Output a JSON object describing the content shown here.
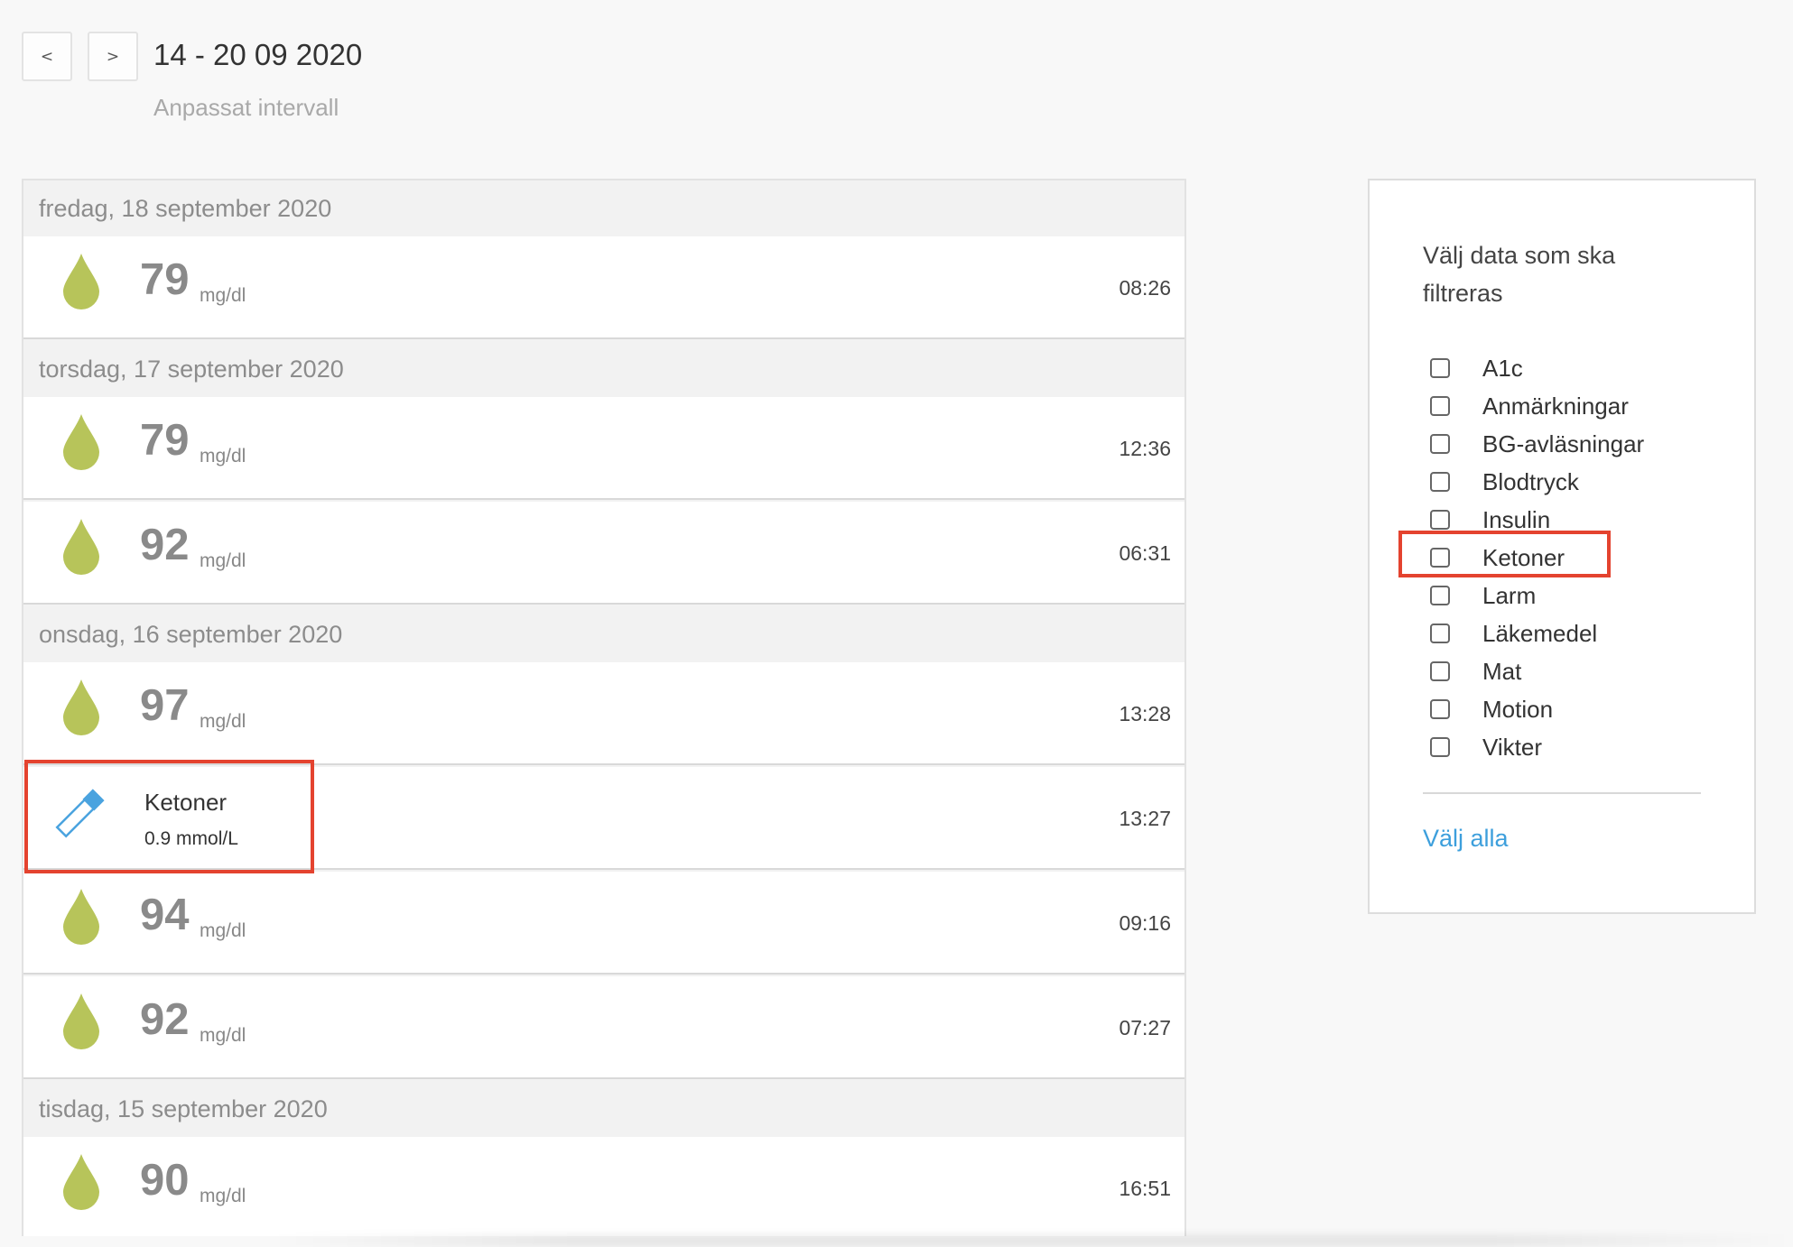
{
  "header": {
    "prev_label": "<",
    "next_label": ">",
    "date_range": "14 - 20 09 2020",
    "custom_range": "Anpassat intervall"
  },
  "colors": {
    "drop_green": "#b7c45a",
    "strip_blue": "#4aa3df",
    "highlight_red": "#e4432f",
    "link_blue": "#3d9fdc"
  },
  "log": {
    "items": [
      {
        "kind": "day",
        "label": "fredag, 18 september 2020"
      },
      {
        "kind": "bg",
        "icon": "blood-drop-icon",
        "value": "79",
        "unit": "mg/dl",
        "time": "08:26"
      },
      {
        "kind": "day",
        "label": "torsdag, 17 september 2020"
      },
      {
        "kind": "bg",
        "icon": "blood-drop-icon",
        "value": "79",
        "unit": "mg/dl",
        "time": "12:36"
      },
      {
        "kind": "bg",
        "icon": "blood-drop-icon",
        "value": "92",
        "unit": "mg/dl",
        "time": "06:31"
      },
      {
        "kind": "day",
        "label": "onsdag, 16 september 2020"
      },
      {
        "kind": "bg",
        "icon": "blood-drop-icon",
        "value": "97",
        "unit": "mg/dl",
        "time": "13:28"
      },
      {
        "kind": "ketone",
        "icon": "ketone-strip-icon",
        "name": "Ketoner",
        "value": "0.9 mmol/L",
        "time": "13:27"
      },
      {
        "kind": "bg",
        "icon": "blood-drop-icon",
        "value": "94",
        "unit": "mg/dl",
        "time": "09:16"
      },
      {
        "kind": "bg",
        "icon": "blood-drop-icon",
        "value": "92",
        "unit": "mg/dl",
        "time": "07:27"
      },
      {
        "kind": "day",
        "label": "tisdag, 15 september 2020"
      },
      {
        "kind": "bg",
        "icon": "blood-drop-icon",
        "value": "90",
        "unit": "mg/dl",
        "time": "16:51"
      }
    ]
  },
  "filter": {
    "title": "Välj data som ska filtreras",
    "options": [
      {
        "label": "A1c",
        "checked": false
      },
      {
        "label": "Anmärkningar",
        "checked": false
      },
      {
        "label": "BG-avläsningar",
        "checked": false
      },
      {
        "label": "Blodtryck",
        "checked": false
      },
      {
        "label": "Insulin",
        "checked": false
      },
      {
        "label": "Ketoner",
        "checked": false
      },
      {
        "label": "Larm",
        "checked": false
      },
      {
        "label": "Läkemedel",
        "checked": false
      },
      {
        "label": "Mat",
        "checked": false
      },
      {
        "label": "Motion",
        "checked": false
      },
      {
        "label": "Vikter",
        "checked": false
      }
    ],
    "select_all": "Välj alla"
  }
}
